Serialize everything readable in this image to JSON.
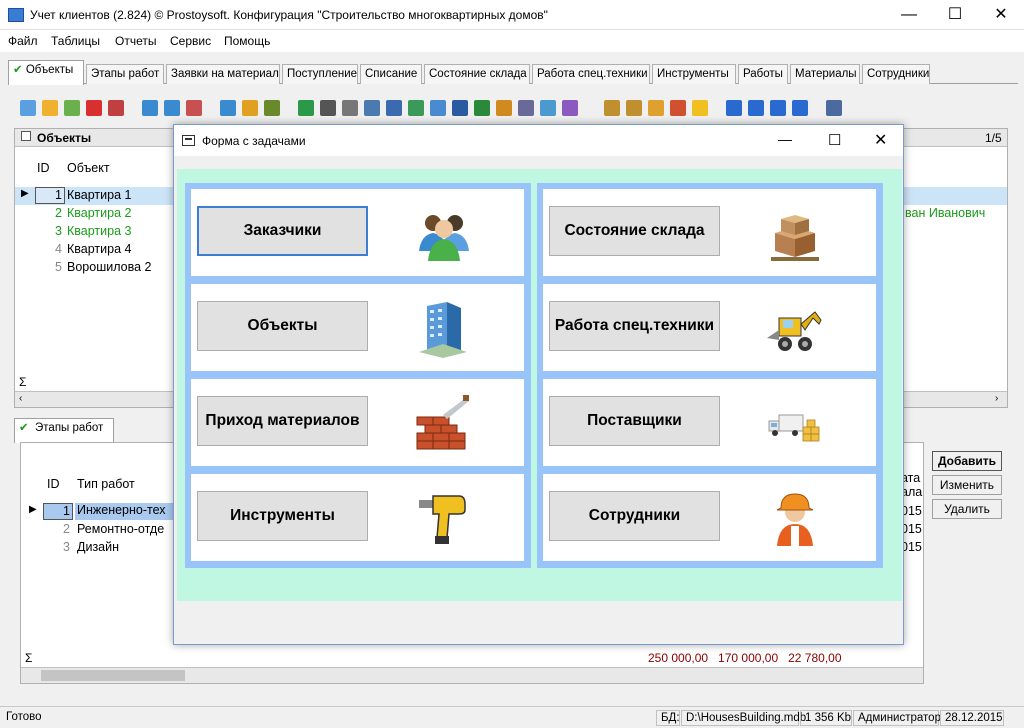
{
  "window": {
    "title": "Учет клиентов (2.824) © Prostoysoft. Конфигурация \"Строительство многоквартирных домов\"",
    "minimize": "—",
    "maximize": "☐",
    "close": "✕"
  },
  "menu": [
    "Файл",
    "Таблицы",
    "Отчеты",
    "Сервис",
    "Помощь"
  ],
  "tabs": [
    "Объекты",
    "Этапы работ",
    "Заявки на материал",
    "Поступление",
    "Списание",
    "Состояние склада",
    "Работа спец.техники",
    "Инструменты",
    "Работы",
    "Материалы",
    "Сотрудники"
  ],
  "objects_panel": {
    "title": "Объекты",
    "pager": "1/5",
    "columns": [
      "ID",
      "Объект"
    ],
    "rows": [
      {
        "id": "1",
        "name": "Квартира 1"
      },
      {
        "id": "2",
        "name": "Квартира 2"
      },
      {
        "id": "3",
        "name": "Квартира 3"
      },
      {
        "id": "4",
        "name": "Квартира 4"
      },
      {
        "id": "5",
        "name": "Ворошилова 2"
      }
    ],
    "right_text": "ван Иванович",
    "sigma": "Σ"
  },
  "lower_panel": {
    "tab": "Этапы работ",
    "columns": [
      "ID",
      "Тип работ"
    ],
    "rows": [
      {
        "id": "1",
        "name": "Инженерно-тех"
      },
      {
        "id": "2",
        "name": "Ремонтно-отде"
      },
      {
        "id": "3",
        "name": "Дизайн"
      }
    ],
    "right_header_1": "ата",
    "right_header_2": "ала",
    "right_values": [
      "015",
      "015",
      "015"
    ],
    "sigma": "Σ",
    "totals": "250 000,00   170 000,00   22 780,00",
    "buttons": {
      "add": "Добавить",
      "edit": "Изменить",
      "delete": "Удалить"
    }
  },
  "statusbar": {
    "ready": "Готово",
    "db_label": "БД:",
    "db_path": "D:\\HousesBuilding.mdb",
    "size": "1 356 Kb",
    "user": "Администратор",
    "date": "28.12.2015"
  },
  "dialog": {
    "title": "Форма с задачами",
    "left_buttons": [
      {
        "label": "Заказчики",
        "icon": "customers-icon"
      },
      {
        "label": "Объекты",
        "icon": "building-icon"
      },
      {
        "label": "Приход материалов",
        "icon": "bricks-icon"
      },
      {
        "label": "Инструменты",
        "icon": "drill-icon"
      }
    ],
    "right_buttons": [
      {
        "label": "Состояние склада",
        "icon": "boxes-icon"
      },
      {
        "label": "Работа спец.техники",
        "icon": "excavator-icon"
      },
      {
        "label": "Поставщики",
        "icon": "delivery-truck-icon"
      },
      {
        "label": "Сотрудники",
        "icon": "worker-icon"
      }
    ]
  },
  "colors": {
    "dialog_bg": "#bff7e2",
    "card_frame": "#99c4f9",
    "selected_row": "#cce4f7",
    "green_text": "#1a9a1a",
    "totals_text": "#8b0000"
  }
}
